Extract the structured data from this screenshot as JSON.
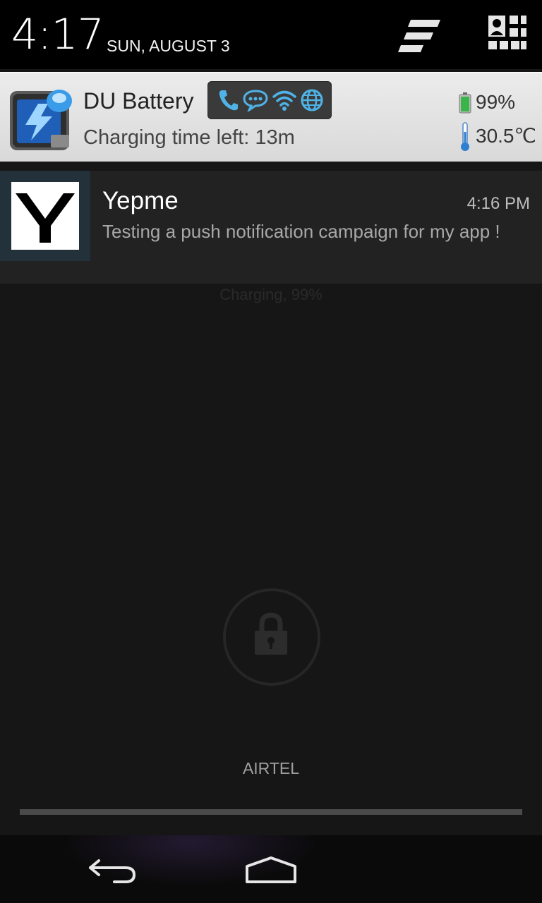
{
  "header": {
    "time": "4:17",
    "date": "SUN, AUGUST 3",
    "icons": [
      "clear-notifications-icon",
      "quick-settings-icon"
    ]
  },
  "notifications": [
    {
      "app": "DU Battery",
      "subtitle": "Charging time left: 13m",
      "battery_percent": "99%",
      "temperature": "30.5℃",
      "toggles": [
        "phone-icon",
        "chat-icon",
        "wifi-icon",
        "globe-icon"
      ],
      "accent_color": "#4fb3e8"
    },
    {
      "app": "Yepme",
      "time": "4:16 PM",
      "text": "Testing a push notification campaign for my app !",
      "logo_letter": "Y"
    }
  ],
  "lockscreen": {
    "charging_text": "Charging, 99%",
    "carrier": "AIRTEL"
  },
  "navbar": {
    "icons": [
      "back-icon",
      "home-icon"
    ]
  }
}
